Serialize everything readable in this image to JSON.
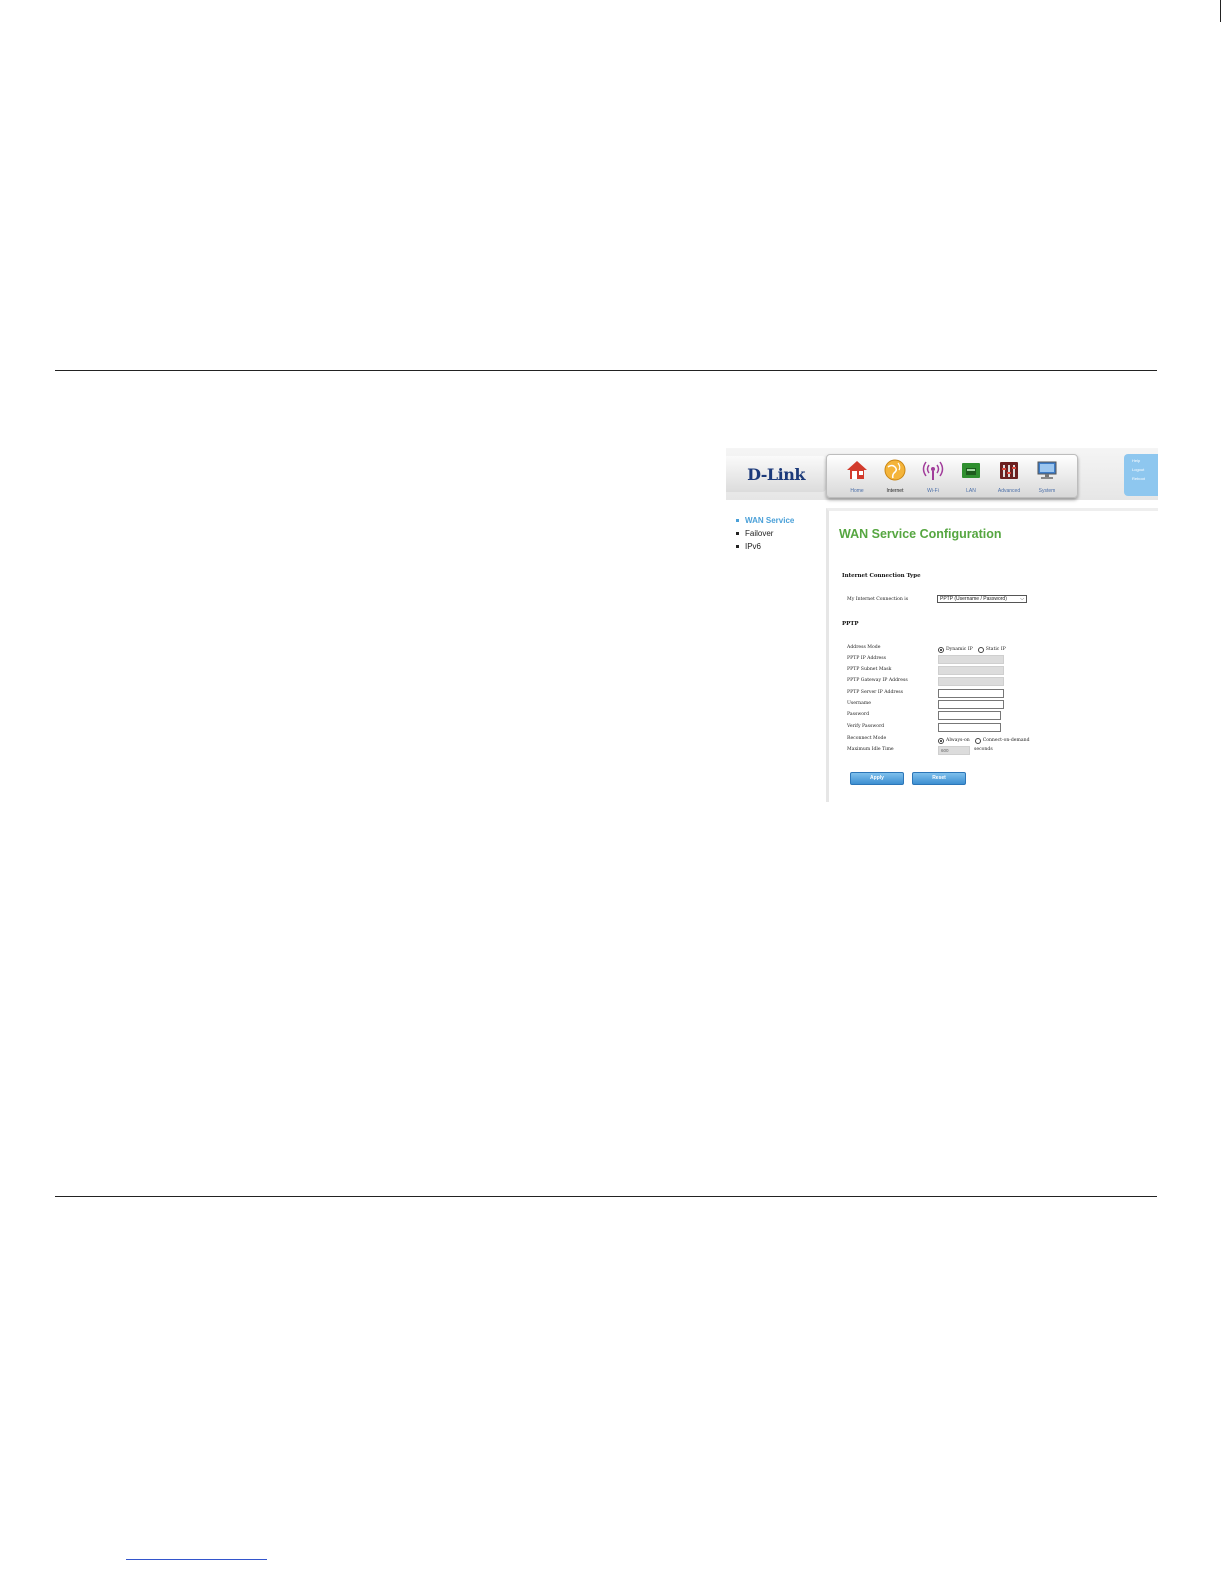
{
  "brand": {
    "logo_text": "D-Link"
  },
  "nav": {
    "items": [
      {
        "label": "Home",
        "icon": "home-icon"
      },
      {
        "label": "Internet",
        "icon": "globe-icon"
      },
      {
        "label": "Wi-Fi",
        "icon": "wifi-icon"
      },
      {
        "label": "LAN",
        "icon": "lan-icon"
      },
      {
        "label": "Advanced",
        "icon": "advanced-icon"
      },
      {
        "label": "System",
        "icon": "monitor-icon"
      }
    ],
    "active": "Internet"
  },
  "help_links": [
    "Help",
    "Logout",
    "Reboot"
  ],
  "sidebar": {
    "items": [
      {
        "label": "WAN Service"
      },
      {
        "label": "Failover"
      },
      {
        "label": "IPv6"
      }
    ]
  },
  "main": {
    "title": "WAN Service Configuration",
    "section_connection": "Internet Connection Type",
    "connection_label": "My Internet Connection is",
    "connection_value": "PPTP (Username / Password)",
    "section_pptp": "PPTP",
    "fields": {
      "address_mode": {
        "label": "Address Mode",
        "options": [
          "Dynamic IP",
          "Static IP"
        ],
        "selected": "Dynamic IP"
      },
      "ip_address": {
        "label": "PPTP IP Address",
        "value": ""
      },
      "subnet_mask": {
        "label": "PPTP Subnet Mask",
        "value": ""
      },
      "gateway_ip": {
        "label": "PPTP Gateway IP Address",
        "value": ""
      },
      "server_ip": {
        "label": "PPTP Server IP Address",
        "value": ""
      },
      "username": {
        "label": "Username",
        "value": ""
      },
      "password": {
        "label": "Password",
        "value": ""
      },
      "verify_password": {
        "label": "Verify Password",
        "value": ""
      },
      "reconnect_mode": {
        "label": "Reconnect Mode",
        "options": [
          "Always-on",
          "Connect-on-demand"
        ],
        "selected": "Always-on"
      },
      "max_idle_time": {
        "label": "Maximum Idle Time",
        "value": "600",
        "unit": "seconds"
      }
    },
    "buttons": {
      "apply": "Apply",
      "reset": "Reset"
    }
  },
  "colors": {
    "title_green": "#55a640",
    "accent_blue": "#4aa0d8",
    "button_blue": "#3d8fd1"
  }
}
